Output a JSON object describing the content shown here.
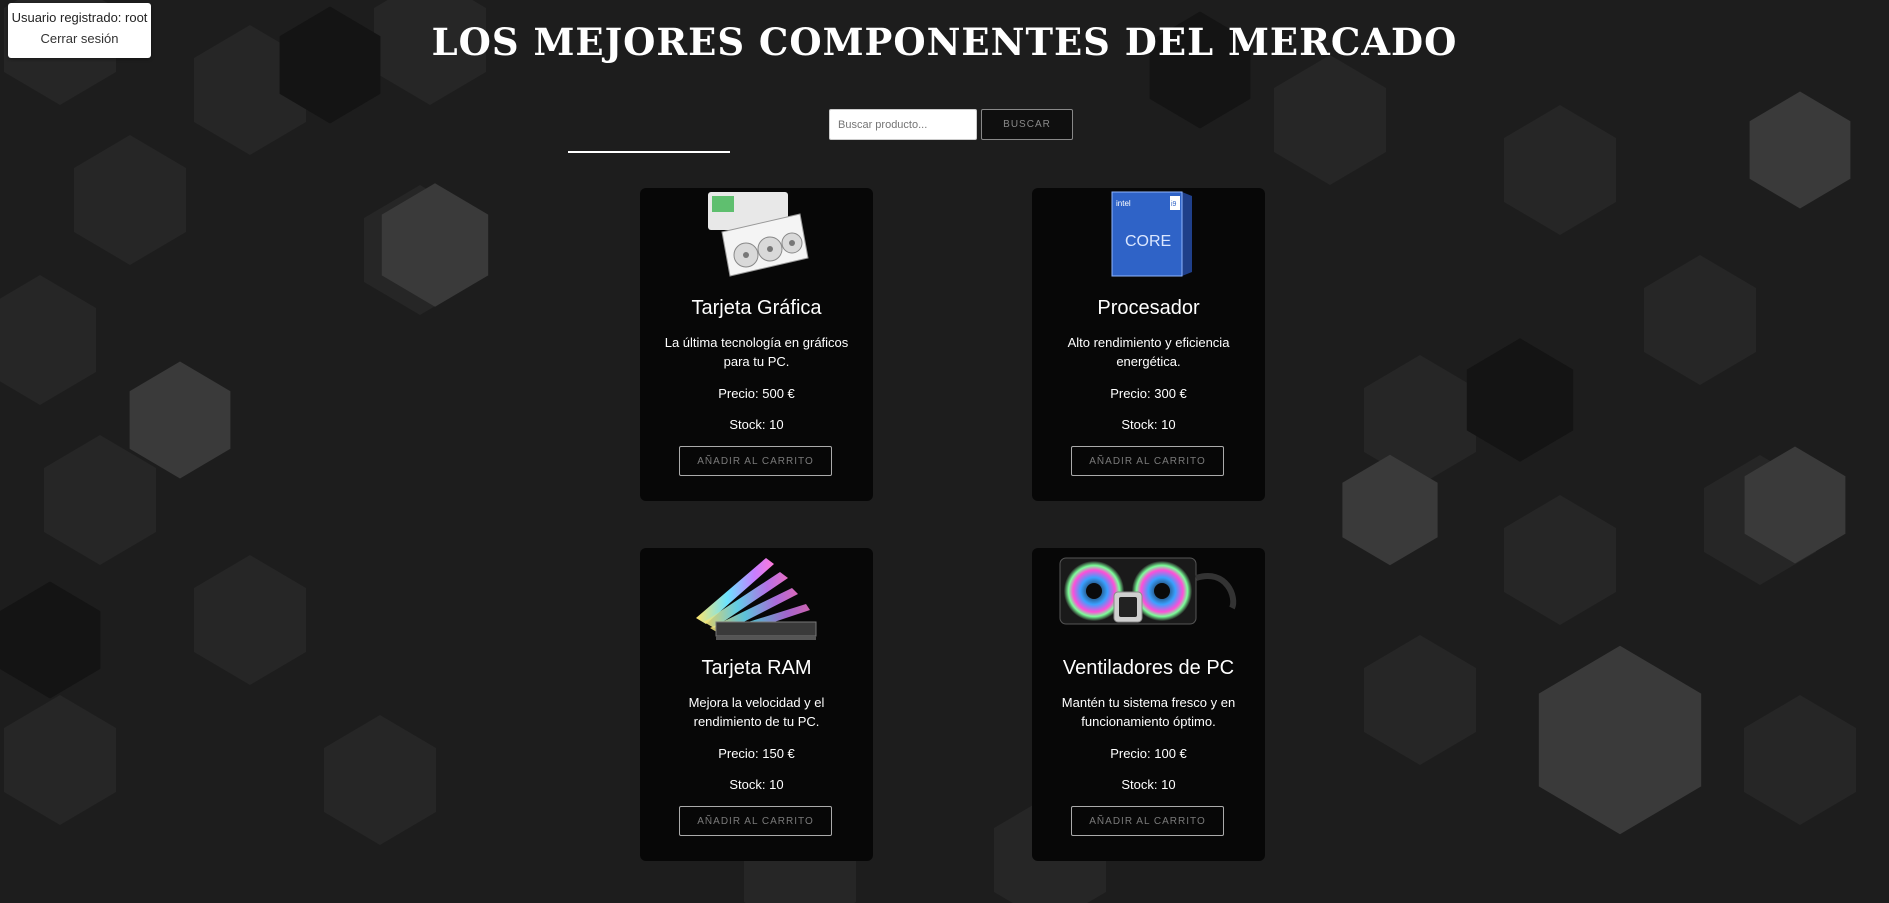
{
  "user_box": {
    "user_text": "Usuario registrado: root",
    "logout_label": "Cerrar sesión"
  },
  "title": "LOS MEJORES COMPONENTES DEL MERCADO",
  "search": {
    "placeholder": "Buscar producto...",
    "button_label": "BUSCAR"
  },
  "products": [
    {
      "name": "Tarjeta Gráfica",
      "description": "La última tecnología en gráficos para tu PC.",
      "price": "Precio: 500 €",
      "stock": "Stock: 10",
      "button_label": "AÑADIR AL CARRITO",
      "image_icon": "graphics-card-icon"
    },
    {
      "name": "Procesador",
      "description": "Alto rendimiento y eficiencia energética.",
      "price": "Precio: 300 €",
      "stock": "Stock: 10",
      "button_label": "AÑADIR AL CARRITO",
      "image_icon": "processor-box-icon",
      "image_text": [
        "intel",
        "CORE",
        "i9"
      ]
    },
    {
      "name": "Tarjeta RAM",
      "description": "Mejora la velocidad y el rendimiento de tu PC.",
      "price": "Precio: 150 €",
      "stock": "Stock: 10",
      "button_label": "AÑADIR AL CARRITO",
      "image_icon": "ram-modules-icon"
    },
    {
      "name": "Ventiladores de PC",
      "description": "Mantén tu sistema fresco y en funcionamiento óptimo.",
      "price": "Precio: 100 €",
      "stock": "Stock: 10",
      "button_label": "AÑADIR AL CARRITO",
      "image_icon": "liquid-cooler-fans-icon"
    }
  ],
  "colors": {
    "background": "#1c1c1c",
    "card": "#070707",
    "text": "#ffffff",
    "button_text": "#7a7a7a"
  }
}
